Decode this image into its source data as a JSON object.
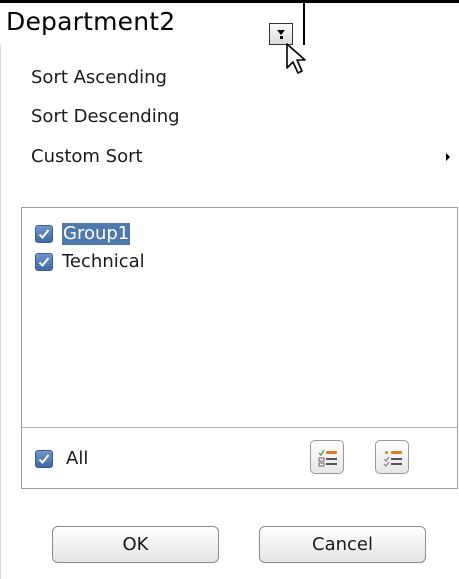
{
  "header": {
    "cell_name": "Department2"
  },
  "menu": {
    "items": [
      {
        "label": "Sort Ascending"
      },
      {
        "label": "Sort Descending"
      },
      {
        "label": "Custom Sort"
      }
    ]
  },
  "filter_list": {
    "items": [
      {
        "label": "Group1",
        "checked": true,
        "selected": true
      },
      {
        "label": "Technical",
        "checked": true,
        "selected": false
      }
    ],
    "all_label": "All",
    "all_checked": true
  },
  "buttons": {
    "ok_label": "OK",
    "cancel_label": "Cancel"
  },
  "icons": {
    "toggle_all": "select-all-icon",
    "select_current": "select-current-icon",
    "dropdown": "chevron-down-icon",
    "submenu": "chevron-right-icon"
  }
}
